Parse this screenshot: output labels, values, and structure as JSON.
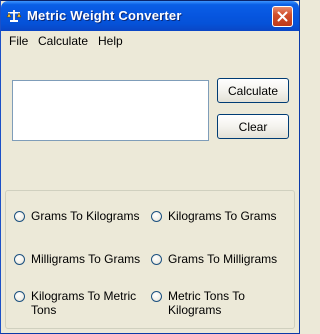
{
  "window": {
    "title": "Metric Weight Converter",
    "title_bar_color": "#0756E0",
    "close_button_color": "#C0391A",
    "app_icon": "scale-icon",
    "close_icon": "close-x-icon"
  },
  "menu": {
    "items": [
      "File",
      "Calculate",
      "Help"
    ]
  },
  "result": {
    "value": ""
  },
  "buttons": {
    "calculate_label": "Calculate",
    "clear_label": "Clear"
  },
  "conversions": {
    "options": [
      "Grams To Kilograms",
      "Kilograms To Grams",
      "Milligrams To Grams",
      "Grams To Milligrams",
      "Kilograms To Metric Tons",
      "Metric Tons To Kilograms"
    ],
    "selected": null
  }
}
